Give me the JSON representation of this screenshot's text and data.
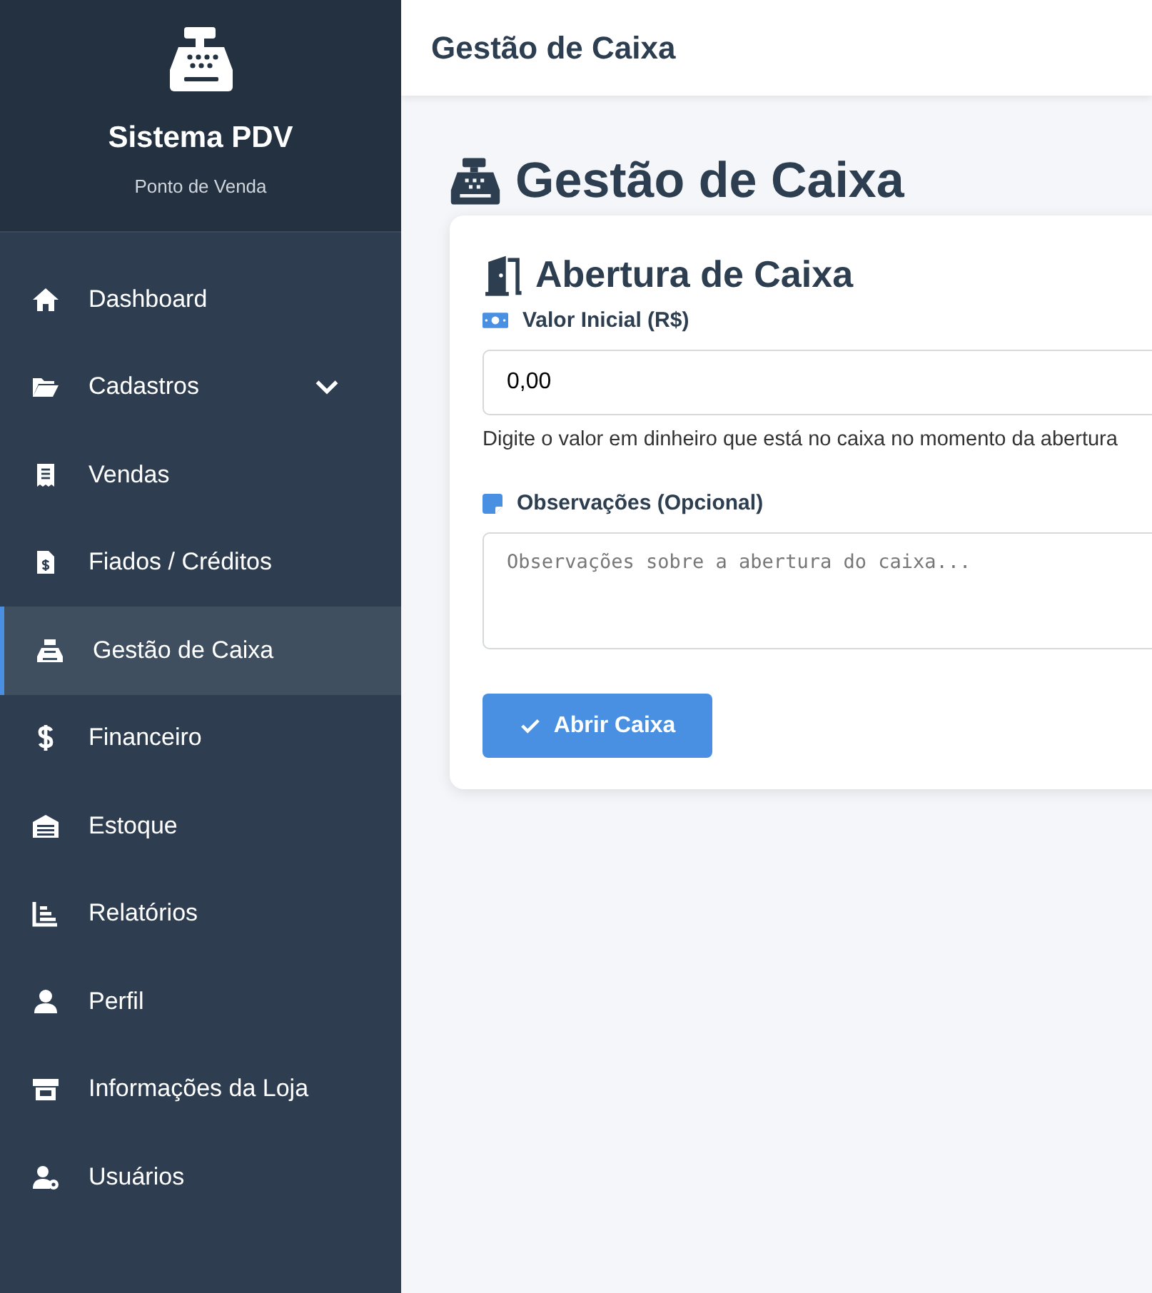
{
  "sidebar": {
    "title": "Sistema PDV",
    "subtitle": "Ponto de Venda",
    "items": [
      {
        "label": "Dashboard",
        "selected": false
      },
      {
        "label": "Cadastros",
        "selected": false,
        "expanded": false
      },
      {
        "label": "Vendas",
        "selected": false
      },
      {
        "label": "Fiados / Créditos",
        "selected": false
      },
      {
        "label": "Gestão de Caixa",
        "selected": true
      },
      {
        "label": "Financeiro",
        "selected": false
      },
      {
        "label": "Estoque",
        "selected": false
      },
      {
        "label": "Relatórios",
        "selected": false
      },
      {
        "label": "Perfil",
        "selected": false
      },
      {
        "label": "Informações da Loja",
        "selected": false
      },
      {
        "label": "Usuários",
        "selected": false
      }
    ]
  },
  "topbar": {
    "title": "Gestão de Caixa"
  },
  "page": {
    "title": "Gestão de Caixa",
    "card": {
      "title": "Abertura de Caixa",
      "initial_value": {
        "label": "Valor Inicial (R$)",
        "value": "0,00",
        "help": "Digite o valor em dinheiro que está no caixa no momento da abertura"
      },
      "notes": {
        "label": "Observações (Opcional)",
        "placeholder": "Observações sobre a abertura do caixa..."
      },
      "button": "Abrir Caixa"
    }
  }
}
